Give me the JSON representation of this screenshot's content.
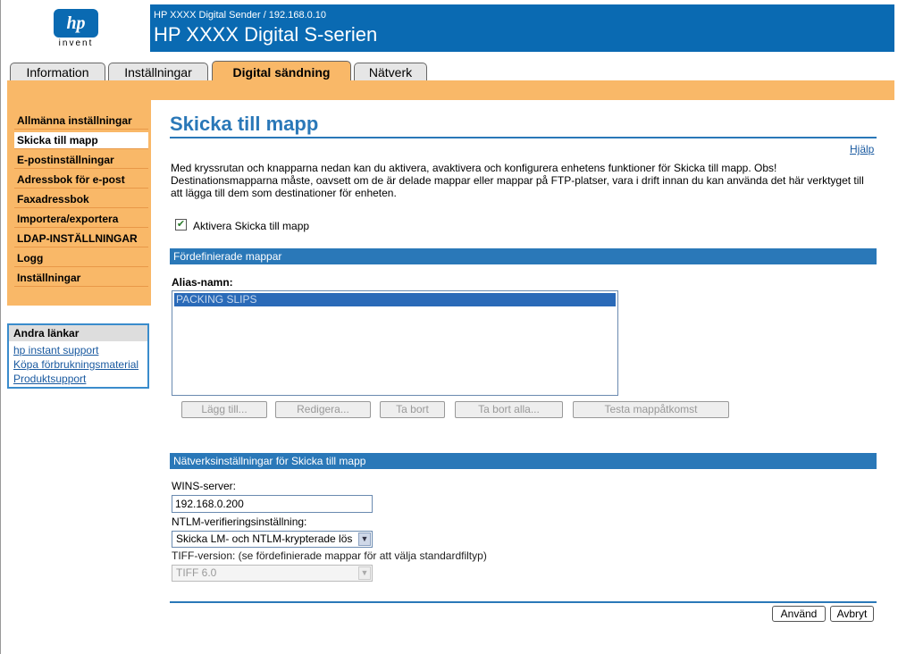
{
  "header": {
    "logo_text": "hp",
    "logo_tagline": "invent",
    "subtitle": "HP XXXX Digital Sender / 192.168.0.10",
    "title": "HP XXXX Digital S-serien"
  },
  "tabs": [
    {
      "label": "Information",
      "active": false
    },
    {
      "label": "Inställningar",
      "active": false
    },
    {
      "label": "Digital sändning",
      "active": true
    },
    {
      "label": "Nätverk",
      "active": false
    }
  ],
  "sidebar": {
    "items": [
      {
        "label": "Allmänna inställningar"
      },
      {
        "label": "Skicka till mapp",
        "selected": true
      },
      {
        "label": "E-postinställningar"
      },
      {
        "label": "Adressbok för e-post"
      },
      {
        "label": "Faxadressbok"
      },
      {
        "label": "Importera/exportera"
      },
      {
        "label": "LDAP-INSTÄLLNINGAR"
      },
      {
        "label": "Logg"
      },
      {
        "label": "Inställningar"
      }
    ],
    "other_links": {
      "title": "Andra länkar",
      "links": [
        "hp instant support",
        "Köpa förbrukningsmaterial",
        "Produktsupport"
      ]
    }
  },
  "main": {
    "title": "Skicka till mapp",
    "help": "Hjälp",
    "intro": "Med kryssrutan och knapparna nedan kan du aktivera, avaktivera och konfigurera enhetens funktioner för Skicka till mapp. Obs! Destinationsmapparna måste, oavsett om de är delade mappar eller mappar på FTP-platser, vara i drift innan du kan använda det här verktyget till att lägga till dem som destinationer för enheten.",
    "enable_label": "Aktivera Skicka till mapp",
    "enable_checked": true,
    "checkmark": "✔",
    "predefined": {
      "section_title": "Fördefinierade mappar",
      "alias_label": "Alias-namn:",
      "aliases": [
        "PACKING SLIPS"
      ],
      "buttons": {
        "add": "Lägg till...",
        "edit": "Redigera...",
        "remove": "Ta bort",
        "remove_all": "Ta bort alla...",
        "test": "Testa mappåtkomst"
      }
    },
    "network": {
      "section_title": "Nätverksinställningar för Skicka till mapp",
      "wins_label": "WINS-server:",
      "wins_value": "192.168.0.200",
      "ntlm_label": "NTLM-verifieringsinställning:",
      "ntlm_value": "Skicka LM- och NTLM-krypterade lös",
      "tiff_label": "TIFF-version: (se fördefinierade mappar för att välja standardfiltyp)",
      "tiff_value": "TIFF 6.0"
    },
    "actions": {
      "apply": "Använd",
      "cancel": "Avbryt"
    }
  },
  "colors": {
    "brand_blue": "#0a6ab2",
    "accent_orange": "#f9b868",
    "section_blue": "#2a78b8"
  }
}
